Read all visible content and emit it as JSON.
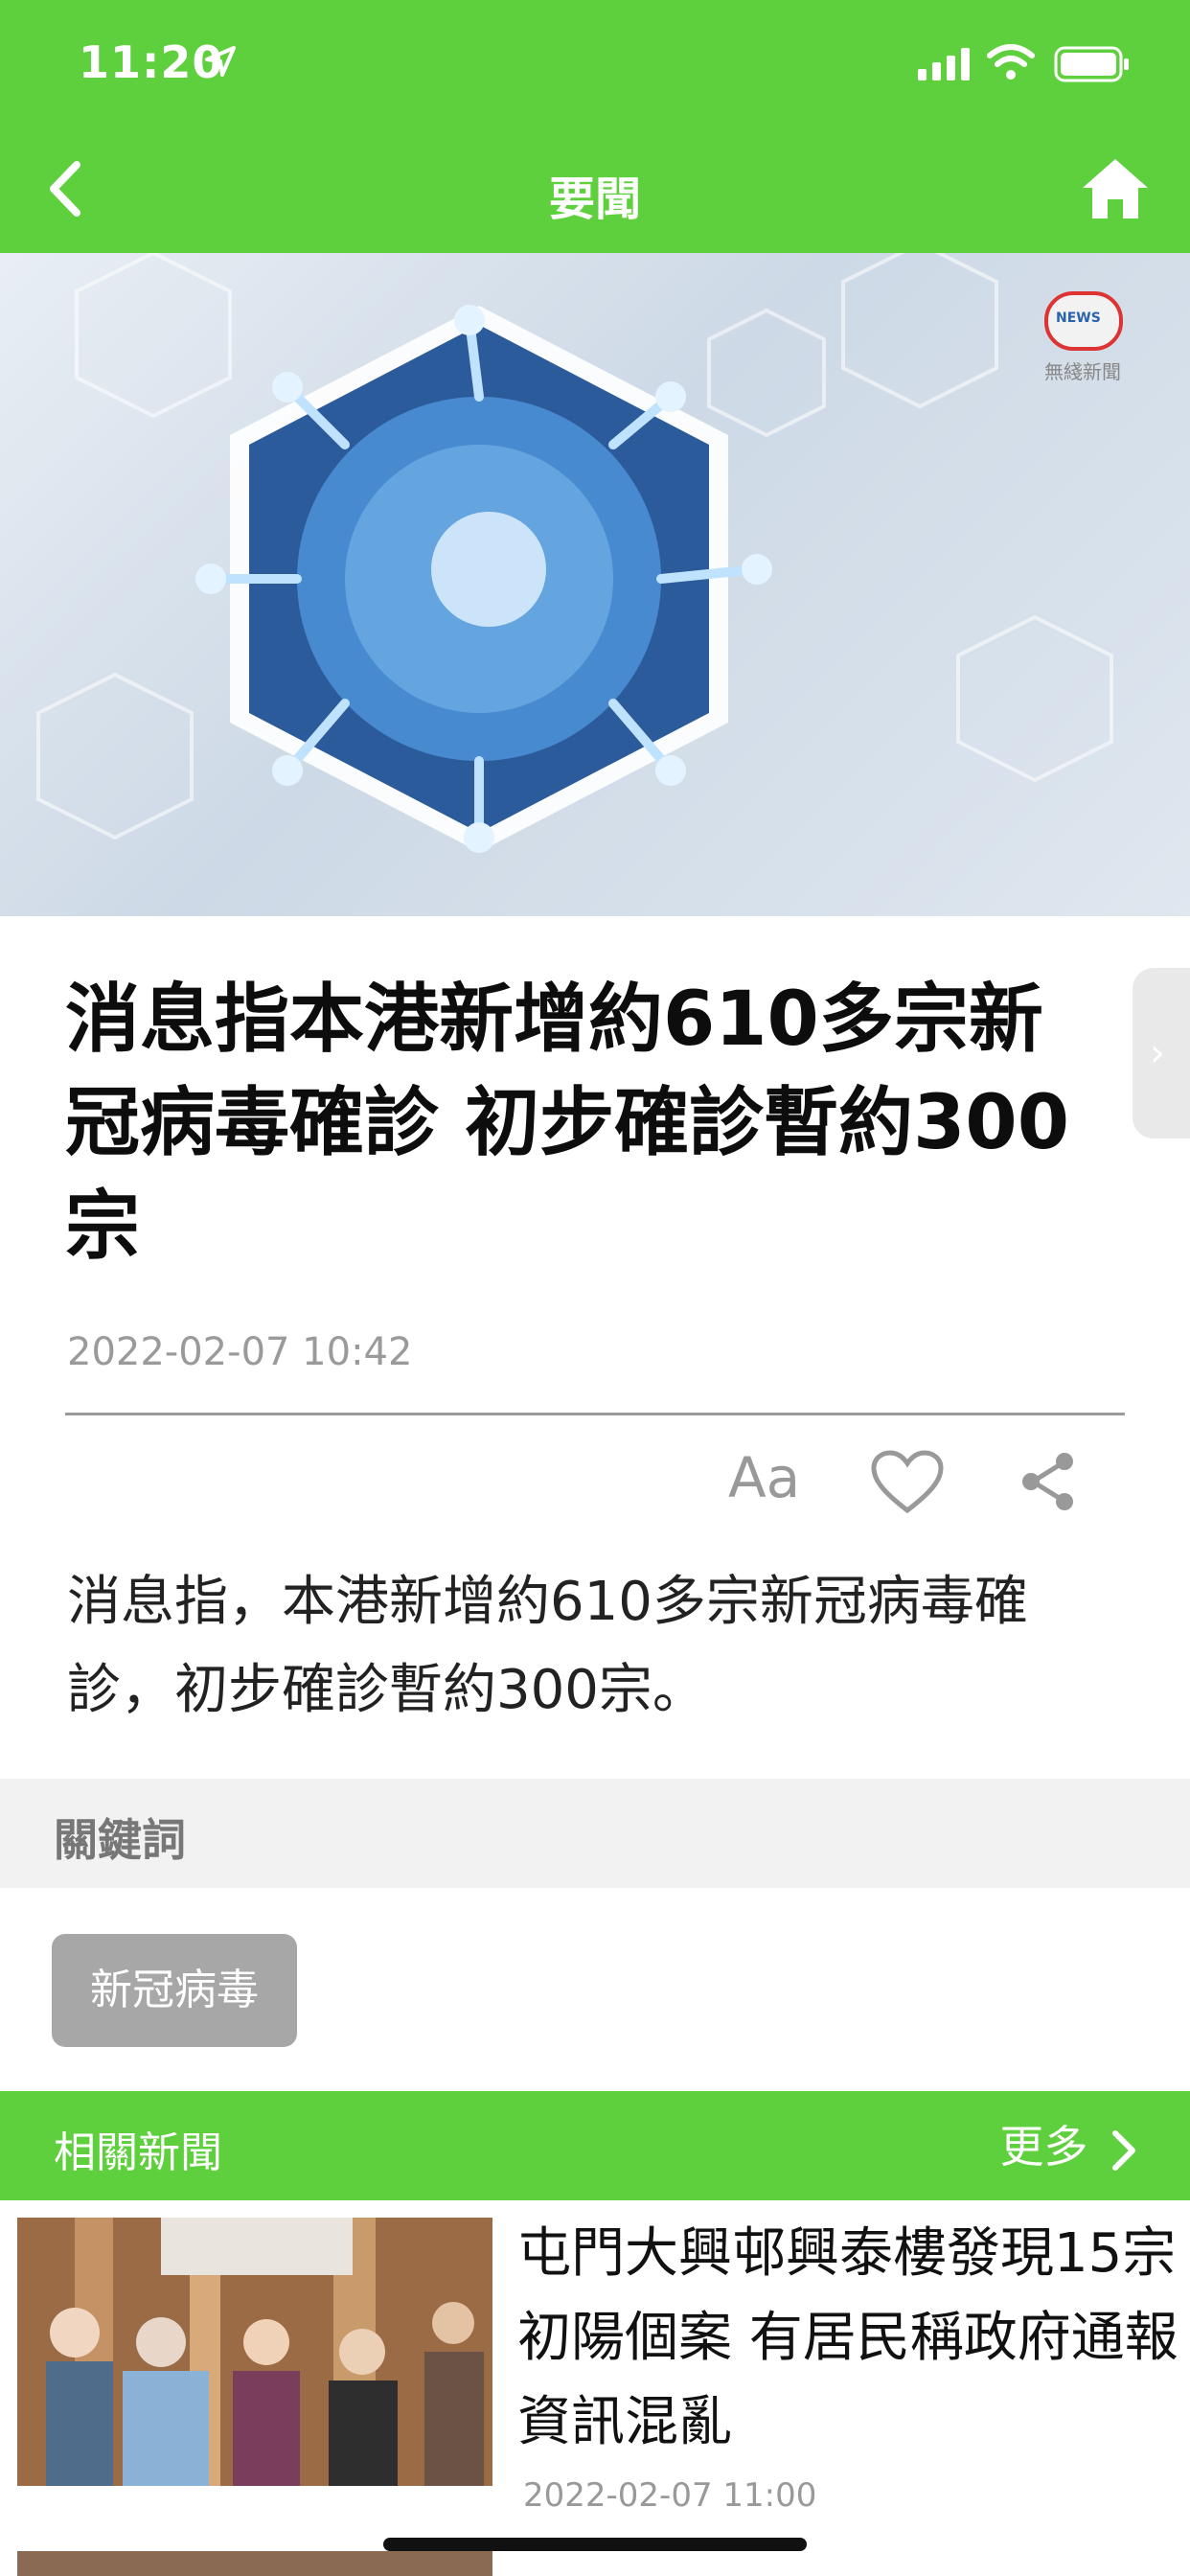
{
  "status_bar": {
    "time": "11:20"
  },
  "nav": {
    "title": "要聞"
  },
  "hero": {
    "logo_text": "NEWS",
    "logo_sub": "無綫新聞"
  },
  "article": {
    "headline": "消息指本港新增約610多宗新冠病毒確診 初步確診暫約300宗",
    "timestamp": "2022-02-07 10:42",
    "font_size_label": "Aa",
    "body": "消息指，本港新增約610多宗新冠病毒確診，初步確診暫約300宗。"
  },
  "keywords": {
    "header": "關鍵詞",
    "items": [
      "新冠病毒"
    ]
  },
  "related": {
    "header": "相關新聞",
    "more": "更多",
    "items": [
      {
        "title": "屯門大興邨興泰樓發現15宗初陽個案 有居民稱政府通報資訊混亂",
        "date": "2022-02-07 11:00"
      }
    ]
  },
  "colors": {
    "brand_green": "#5ecf3d",
    "chip_gray": "#a7a7a7"
  }
}
